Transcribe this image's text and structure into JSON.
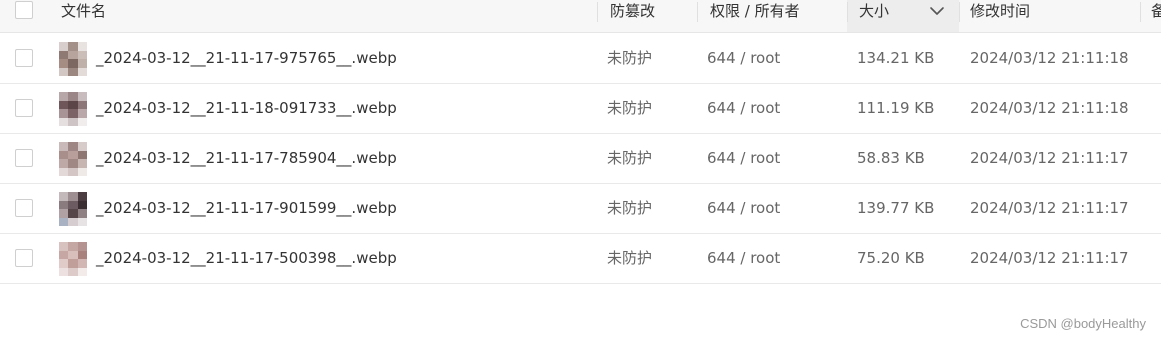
{
  "header": {
    "name": "文件名",
    "protect": "防篡改",
    "perm": "权限 / 所有者",
    "size": "大小",
    "mtime": "修改时间",
    "extra": "备"
  },
  "rows": [
    {
      "name": "_2024-03-12__21-11-17-975765__.webp",
      "protect": "未防护",
      "perm": "644 / root",
      "size": "134.21 KB",
      "mtime": "2024/03/12 21:11:18"
    },
    {
      "name": "_2024-03-12__21-11-18-091733__.webp",
      "protect": "未防护",
      "perm": "644 / root",
      "size": "111.19 KB",
      "mtime": "2024/03/12 21:11:18"
    },
    {
      "name": "_2024-03-12__21-11-17-785904__.webp",
      "protect": "未防护",
      "perm": "644 / root",
      "size": "58.83 KB",
      "mtime": "2024/03/12 21:11:17"
    },
    {
      "name": "_2024-03-12__21-11-17-901599__.webp",
      "protect": "未防护",
      "perm": "644 / root",
      "size": "139.77 KB",
      "mtime": "2024/03/12 21:11:17"
    },
    {
      "name": "_2024-03-12__21-11-17-500398__.webp",
      "protect": "未防护",
      "perm": "644 / root",
      "size": "75.20 KB",
      "mtime": "2024/03/12 21:11:17"
    }
  ],
  "icons": {
    "sort": "chevron-down-icon",
    "thumbnail": "image-thumbnail-icon"
  },
  "watermark": "CSDN @bodyHealthy"
}
